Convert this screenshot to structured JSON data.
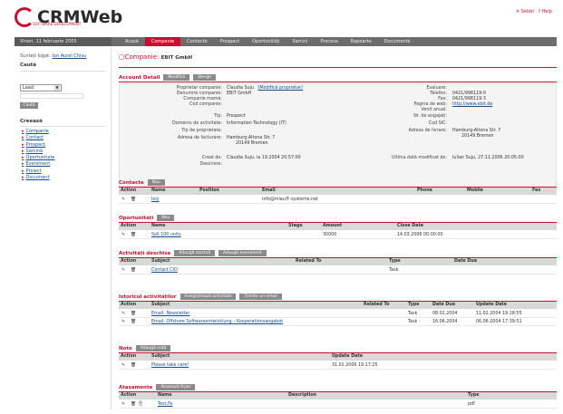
{
  "header": {
    "logo_text": "CRMWeb",
    "logo_sub": "SOFTWARE DEVELOPMENT",
    "links": [
      "Setări",
      "Help"
    ]
  },
  "nav": {
    "date": "Vineri, 11 februarie 2005",
    "tabs": [
      "Acasă",
      "Companie",
      "Contacte",
      "Prospect",
      "Oportunități",
      "Sarcini",
      "Procese",
      "Rapoarte",
      "Documente"
    ],
    "active_index": 1
  },
  "sidebar": {
    "login_prefix": "Sunteți logat:",
    "login_user": "Ion Aurel Chivu",
    "search_title": "Caută",
    "select_value": "Lead",
    "search_button": "Caută",
    "create_title": "Creează",
    "create_items": [
      "Companie",
      "Contact",
      "Prospect",
      "Sarcină",
      "Oportunitate",
      "Eveniment",
      "Proiect",
      "Document"
    ]
  },
  "page": {
    "title": "Companie:",
    "company": "EBIT GmbH"
  },
  "account_detail": {
    "title": "Account Detail",
    "buttons": [
      "Modifică",
      "Șterge"
    ],
    "left_labels": [
      "Proprietar companie:",
      "Denumire companie:",
      "Companie mamă:",
      "Cod companie:",
      "Tip:",
      "Domeniu de activitate:",
      "Tip de proprietate:",
      "Adresa de facturare:"
    ],
    "left_values": [
      "Claudia Suju",
      "EBIT GmbH",
      "",
      "",
      "Prospect",
      "Information Technology (IT)",
      "",
      "Hamburg-Altona Str. 7"
    ],
    "owner_link": "[Modifică proprietar]",
    "billing_line2": "20149 Bremen",
    "right_labels": [
      "Evaluare:",
      "Telefon:",
      "Fax:",
      "Pagina de web:",
      "Venit anual:",
      "Nr. de angajați:",
      "Cod SIC:",
      "Adresa de livrare:"
    ],
    "right_values": [
      "",
      "0421/998119-0",
      "0421/998119-3",
      "http://www.ebit.de",
      "",
      "",
      "",
      "Hamburg-Altona Str. 7"
    ],
    "shipping_line2": "20149 Bremen",
    "created_label": "Creat de:",
    "created_value": "Claudia Suju, la 19.2004 20:57:00",
    "modified_label": "Ultima dată modificat de:",
    "modified_value": "Iulian Suju, 27.11.2006 20:05:00",
    "description_label": "Descriere:"
  },
  "contacts": {
    "title": "Contacte",
    "button": "Nou",
    "columns": [
      "Action",
      "Name",
      "Position",
      "Email",
      "Phone",
      "Mobile",
      "Fax"
    ],
    "rows": [
      {
        "name": "Ioly",
        "position": "",
        "email": "info@miau®-systeme.net"
      }
    ]
  },
  "opportunities": {
    "title": "Oportunități",
    "button": "Nou",
    "columns": [
      "Action",
      "Name",
      "Stage",
      "Amount",
      "Close Date"
    ],
    "rows": [
      {
        "name": "Soll 100 units",
        "stage": "",
        "amount": "30000",
        "close": "14.03.2006 00:00:00"
      }
    ]
  },
  "open_activities": {
    "title": "Activități deschise",
    "buttons": [
      "Adaugă sarcină",
      "Adaugă eveniment"
    ],
    "columns": [
      "Action",
      "Subject",
      "Related To",
      "Type",
      "Date Due"
    ],
    "rows": [
      {
        "subject": "Contact CIO",
        "related": "",
        "type": "Task",
        "due": ""
      }
    ]
  },
  "history": {
    "title": "Istoricul activităților",
    "buttons": [
      "Înregistrează activitate",
      "Trimite un email"
    ],
    "columns": [
      "Action",
      "Subject",
      "Related To",
      "Type",
      "Date Due",
      "Update Date"
    ],
    "rows": [
      {
        "subject": "Email: Newsletter",
        "type": "Task",
        "due": "08.02.2004",
        "updated": "11.02.2004 19:18:55"
      },
      {
        "subject": "Email: Offshore Softwareentwicklung – Kooperationsangebot",
        "type": "Task",
        "due": "16.06.2004",
        "updated": "06.06.2004 17:39:51"
      }
    ]
  },
  "notes": {
    "title": "Note",
    "button": "Adaugă notă",
    "columns": [
      "Action",
      "Subject",
      "Update Date"
    ],
    "rows": [
      {
        "subject": "Please take care!",
        "updated": "31.02.2006 19:17:25"
      }
    ]
  },
  "attachments": {
    "title": "Atașamente",
    "button": "Atașează fișier",
    "columns": [
      "Action",
      "Name",
      "Description",
      "Type"
    ],
    "rows": [
      {
        "name": "Test.fls",
        "description": "",
        "type": "pdf"
      }
    ]
  }
}
